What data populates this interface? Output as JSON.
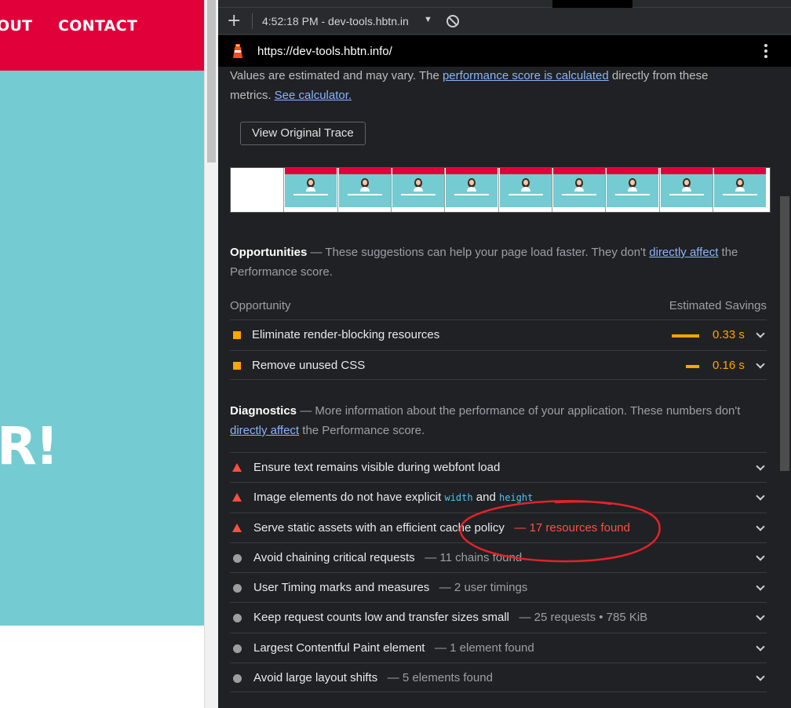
{
  "site": {
    "nav": [
      "OUT",
      "CONTACT"
    ],
    "hero_text": "R!"
  },
  "devtools": {
    "toolbar": {
      "session": "4:52:18 PM - dev-tools.hbtn.in"
    },
    "url": "https://dev-tools.hbtn.info/",
    "intro": {
      "text1": "Values are estimated and may vary. The ",
      "link1": "performance score is calculated",
      "text2": " directly from these metrics. ",
      "link2": "See calculator."
    },
    "view_trace_label": "View Original Trace",
    "opportunities": {
      "title": "Opportunities",
      "desc1": " — These suggestions can help your page load faster. They don't ",
      "link": "directly affect",
      "desc2": " the Performance score.",
      "col_left": "Opportunity",
      "col_right": "Estimated Savings",
      "items": [
        {
          "label": "Eliminate render-blocking resources",
          "saving": "0.33 s"
        },
        {
          "label": "Remove unused CSS",
          "saving": "0.16 s"
        }
      ]
    },
    "diagnostics": {
      "title": "Diagnostics",
      "desc1": " — More information about the performance of your application. These numbers don't ",
      "link": "directly affect",
      "desc2": " the Performance score.",
      "items": [
        {
          "label": "Ensure text remains visible during webfont load",
          "extra": ""
        },
        {
          "label": "Image elements do not have explicit ",
          "code1": "width",
          "mid": " and ",
          "code2": "height"
        },
        {
          "label": "Serve static assets with an efficient cache policy",
          "extra": "— 17 resources found"
        },
        {
          "label": "Avoid chaining critical requests",
          "extra": "— 11 chains found"
        },
        {
          "label": "User Timing marks and measures",
          "extra": "— 2 user timings"
        },
        {
          "label": "Keep request counts low and transfer sizes small",
          "extra": "— 25 requests • 785 KiB"
        },
        {
          "label": "Largest Contentful Paint element",
          "extra": "— 1 element found"
        },
        {
          "label": "Avoid large layout shifts",
          "extra": "— 5 elements found"
        }
      ]
    },
    "colors": {
      "accent": "#8ab4f8",
      "warning": "#ffa400",
      "fail": "#ff4e42",
      "annotation": "#e3222a"
    },
    "icons": [
      "plus-icon",
      "no-entry-icon",
      "lighthouse-icon",
      "kebab-menu-icon",
      "chevron-down-icon",
      "square-warning-icon",
      "triangle-fail-icon",
      "circle-info-icon"
    ]
  }
}
